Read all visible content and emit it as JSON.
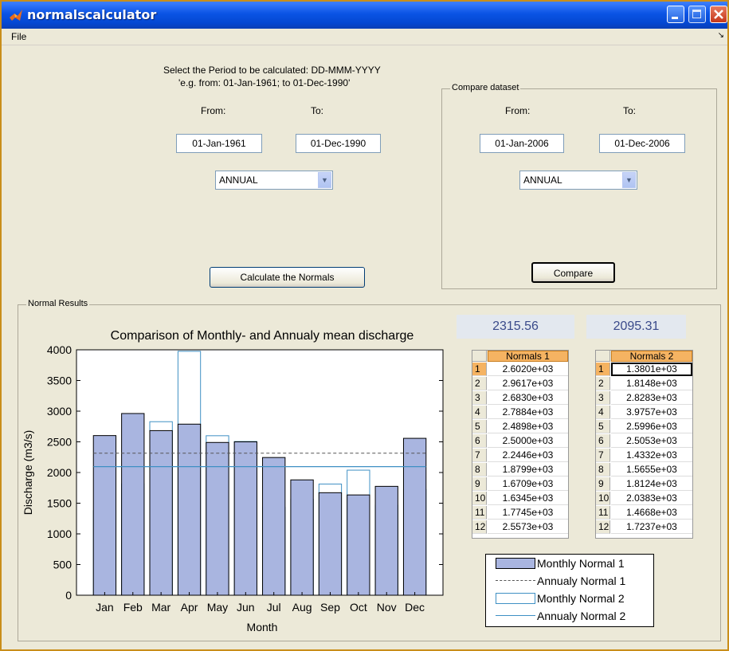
{
  "window": {
    "title": "normalscalculator",
    "menu": {
      "file": "File",
      "overflow_arrow": "↘"
    }
  },
  "period": {
    "instruction_line1": "Select the Period to be calculated: DD-MMM-YYYY",
    "instruction_line2": "'e.g. from: 01-Jan-1961; to 01-Dec-1990'",
    "from_label": "From:",
    "to_label": "To:",
    "from_value": "01-Jan-1961",
    "to_value": "01-Dec-1990",
    "period_select": "ANNUAL",
    "calculate_button": "Calculate the Normals"
  },
  "compare": {
    "group_title": "Compare dataset",
    "from_label": "From:",
    "to_label": "To:",
    "from_value": "01-Jan-2006",
    "to_value": "01-Dec-2006",
    "period_select": "ANNUAL",
    "compare_button": "Compare"
  },
  "results": {
    "group_title": "Normal Results",
    "annual_value_1": "2315.56",
    "annual_value_2": "2095.31",
    "table1": {
      "header": "Normals 1",
      "rows": [
        {
          "n": "1",
          "v": "2.6020e+03"
        },
        {
          "n": "2",
          "v": "2.9617e+03"
        },
        {
          "n": "3",
          "v": "2.6830e+03"
        },
        {
          "n": "4",
          "v": "2.7884e+03"
        },
        {
          "n": "5",
          "v": "2.4898e+03"
        },
        {
          "n": "6",
          "v": "2.5000e+03"
        },
        {
          "n": "7",
          "v": "2.2446e+03"
        },
        {
          "n": "8",
          "v": "1.8799e+03"
        },
        {
          "n": "9",
          "v": "1.6709e+03"
        },
        {
          "n": "10",
          "v": "1.6345e+03"
        },
        {
          "n": "11",
          "v": "1.7745e+03"
        },
        {
          "n": "12",
          "v": "2.5573e+03"
        }
      ]
    },
    "table2": {
      "header": "Normals 2",
      "rows": [
        {
          "n": "1",
          "v": "1.3801e+03"
        },
        {
          "n": "2",
          "v": "1.8148e+03"
        },
        {
          "n": "3",
          "v": "2.8283e+03"
        },
        {
          "n": "4",
          "v": "3.9757e+03"
        },
        {
          "n": "5",
          "v": "2.5996e+03"
        },
        {
          "n": "6",
          "v": "2.5053e+03"
        },
        {
          "n": "7",
          "v": "1.4332e+03"
        },
        {
          "n": "8",
          "v": "1.5655e+03"
        },
        {
          "n": "9",
          "v": "1.8124e+03"
        },
        {
          "n": "10",
          "v": "2.0383e+03"
        },
        {
          "n": "11",
          "v": "1.4668e+03"
        },
        {
          "n": "12",
          "v": "1.7237e+03"
        }
      ]
    },
    "legend": {
      "monthly1": "Monthly Normal 1",
      "annual1": "Annualy Normal 1",
      "monthly2": "Monthly Normal 2",
      "annual2": "Annualy Normal 2"
    }
  },
  "colors": {
    "normal1_fill": "#a9b5e0",
    "normal2_edge": "#3f90c4",
    "annual1_dash": "#555555"
  },
  "chart_data": {
    "type": "bar",
    "title": "Comparison of Monthly- and Annualy mean discharge",
    "xlabel": "Month",
    "ylabel": "Discharge (m3/s)",
    "ylim": [
      0,
      4000
    ],
    "yticks": [
      "0",
      "500",
      "1000",
      "1500",
      "2000",
      "2500",
      "3000",
      "3500",
      "4000"
    ],
    "categories": [
      "Jan",
      "Feb",
      "Mar",
      "Apr",
      "May",
      "Jun",
      "Jul",
      "Aug",
      "Sep",
      "Oct",
      "Nov",
      "Dec"
    ],
    "series": [
      {
        "name": "Monthly Normal 1",
        "values": [
          2602.0,
          2961.7,
          2683.0,
          2788.4,
          2489.8,
          2500.0,
          2244.6,
          1879.9,
          1670.9,
          1634.5,
          1774.5,
          2557.3
        ]
      },
      {
        "name": "Monthly Normal 2",
        "values": [
          1380.1,
          1814.8,
          2828.3,
          3975.7,
          2599.6,
          2505.3,
          1433.2,
          1565.5,
          1812.4,
          2038.3,
          1466.8,
          1723.7
        ]
      }
    ],
    "annual_lines": [
      {
        "name": "Annualy Normal 1",
        "value": 2315.56
      },
      {
        "name": "Annualy Normal 2",
        "value": 2095.31
      }
    ],
    "grid": false,
    "legend_position": "below-right"
  }
}
